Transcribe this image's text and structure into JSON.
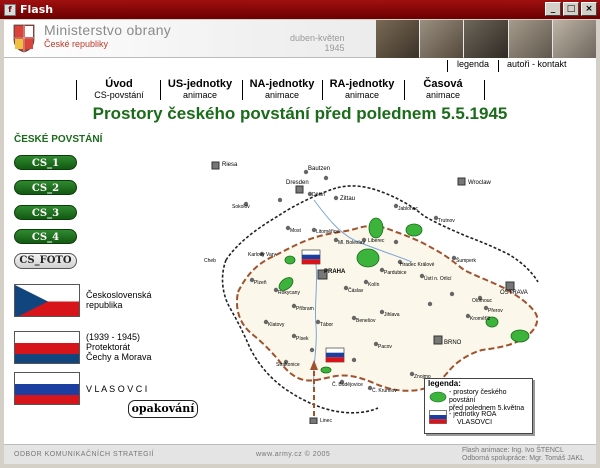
{
  "window": {
    "title": "Flash",
    "buttons": [
      "_",
      "□",
      "×"
    ]
  },
  "header": {
    "ministry": "Ministerstvo obrany",
    "republic": "České republiky",
    "dates_line1": "duben-květen",
    "dates_line2": "1945"
  },
  "toplinks": {
    "legend": "legenda",
    "authors": "autoři - kontakt"
  },
  "nav": [
    {
      "title": "Úvod",
      "subtitle": "CS-povstání"
    },
    {
      "title": "US-jednotky",
      "subtitle": "animace"
    },
    {
      "title": "NA-jednotky",
      "subtitle": "animace"
    },
    {
      "title": "RA-jednotky",
      "subtitle": "animace"
    },
    {
      "title": "Časová",
      "subtitle": "animace"
    }
  ],
  "page_title": "Prostory českého povstání před polednem 5.5.1945",
  "sidebar": {
    "label": "ČESKÉ POVSTÁNÍ",
    "buttons": [
      "CS_1",
      "CS_2",
      "CS_3",
      "CS_4"
    ],
    "foto": "CS_FOTO",
    "flags": [
      {
        "line1": "Československá",
        "line2": "republika",
        "line3": ""
      },
      {
        "line1": "(1939 - 1945)",
        "line2": "Protektorát",
        "line3": "Čechy a Morava"
      },
      {
        "line1": "V L A S O V C I",
        "line2": "",
        "line3": ""
      }
    ],
    "replay": "opakování"
  },
  "map": {
    "cities": {
      "praha": "PRAHA",
      "brno": "BRNO",
      "ostrava": "OSTRAVA",
      "riesa": "Riesa",
      "bautzen": "Bautzen",
      "dresden": "Dresden",
      "zittau": "Zittau",
      "wroclaw": "Wroclaw",
      "glogow": "Glogow",
      "podmokly": "Děčín",
      "sokolov": "Sokolov",
      "liberec": "Liberec",
      "jablonec": "Jablonec",
      "most": "Most",
      "chomutov": "Chomutov",
      "litomerice": "Litoměřice",
      "karlovy_vary": "Karlovy Vary",
      "kladno": "Kladno",
      "mlada_boleslav": "Ml. Boleslav",
      "hradec": "Hradec Králové",
      "pardubice": "Pardubice",
      "kolin": "Kolín",
      "caslav": "Čáslav",
      "usti": "Ústí n. Orlicí",
      "zlin": "Zlín",
      "plzen": "Plzeň",
      "rokycany": "Rokycany",
      "pribram": "Příbram",
      "benesov": "Benešov",
      "pisek": "Písek",
      "tabor": "Tábor",
      "jihlava": "Jihlava",
      "strakonice": "Strakonice",
      "pacov": "Pacov",
      "budejovice": "Č. Budějovice",
      "znojmo": "Znojmo",
      "linec": "Linec",
      "klatovy": "Klatovy",
      "cheb": "Cheb",
      "olomouc": "Olomouc",
      "prerov": "Přerov",
      "vsetin": "Vsetín",
      "krumlov": "Č. Krumlov",
      "jindrichuv": "J. Hradec",
      "nymburk": "Nymburk",
      "semily": "Semily",
      "trutnov": "Trutnov",
      "nachod": "Náchod",
      "sumperk": "Šumperk",
      "opava": "Opava",
      "kromeriz": "Kroměříž",
      "breclav": "Břeclav",
      "trebic": "Třebíč"
    },
    "legend": {
      "title": "legenda:",
      "item1_l1": "- prostory českého povstání",
      "item1_l2": "před polednem 5.května",
      "item2_l1": "- jednotky ROA",
      "item2_l2": "VLASOVCI"
    }
  },
  "footer": {
    "left": "ODBOR KOMUNIKAČNÍCH STRATEGIÍ",
    "center": "www.army.cz © 2005",
    "right_line1": "Flash animace: Ing. Ivo ŠTENCL",
    "right_line2": "Odborná spolupráce: Mgr. Tomáš JAKL"
  },
  "colors": {
    "title_green": "#1a6b1a",
    "border_brown": "#a0522d",
    "uprising_green": "#3cb43c",
    "window_red": "#8b0000"
  }
}
